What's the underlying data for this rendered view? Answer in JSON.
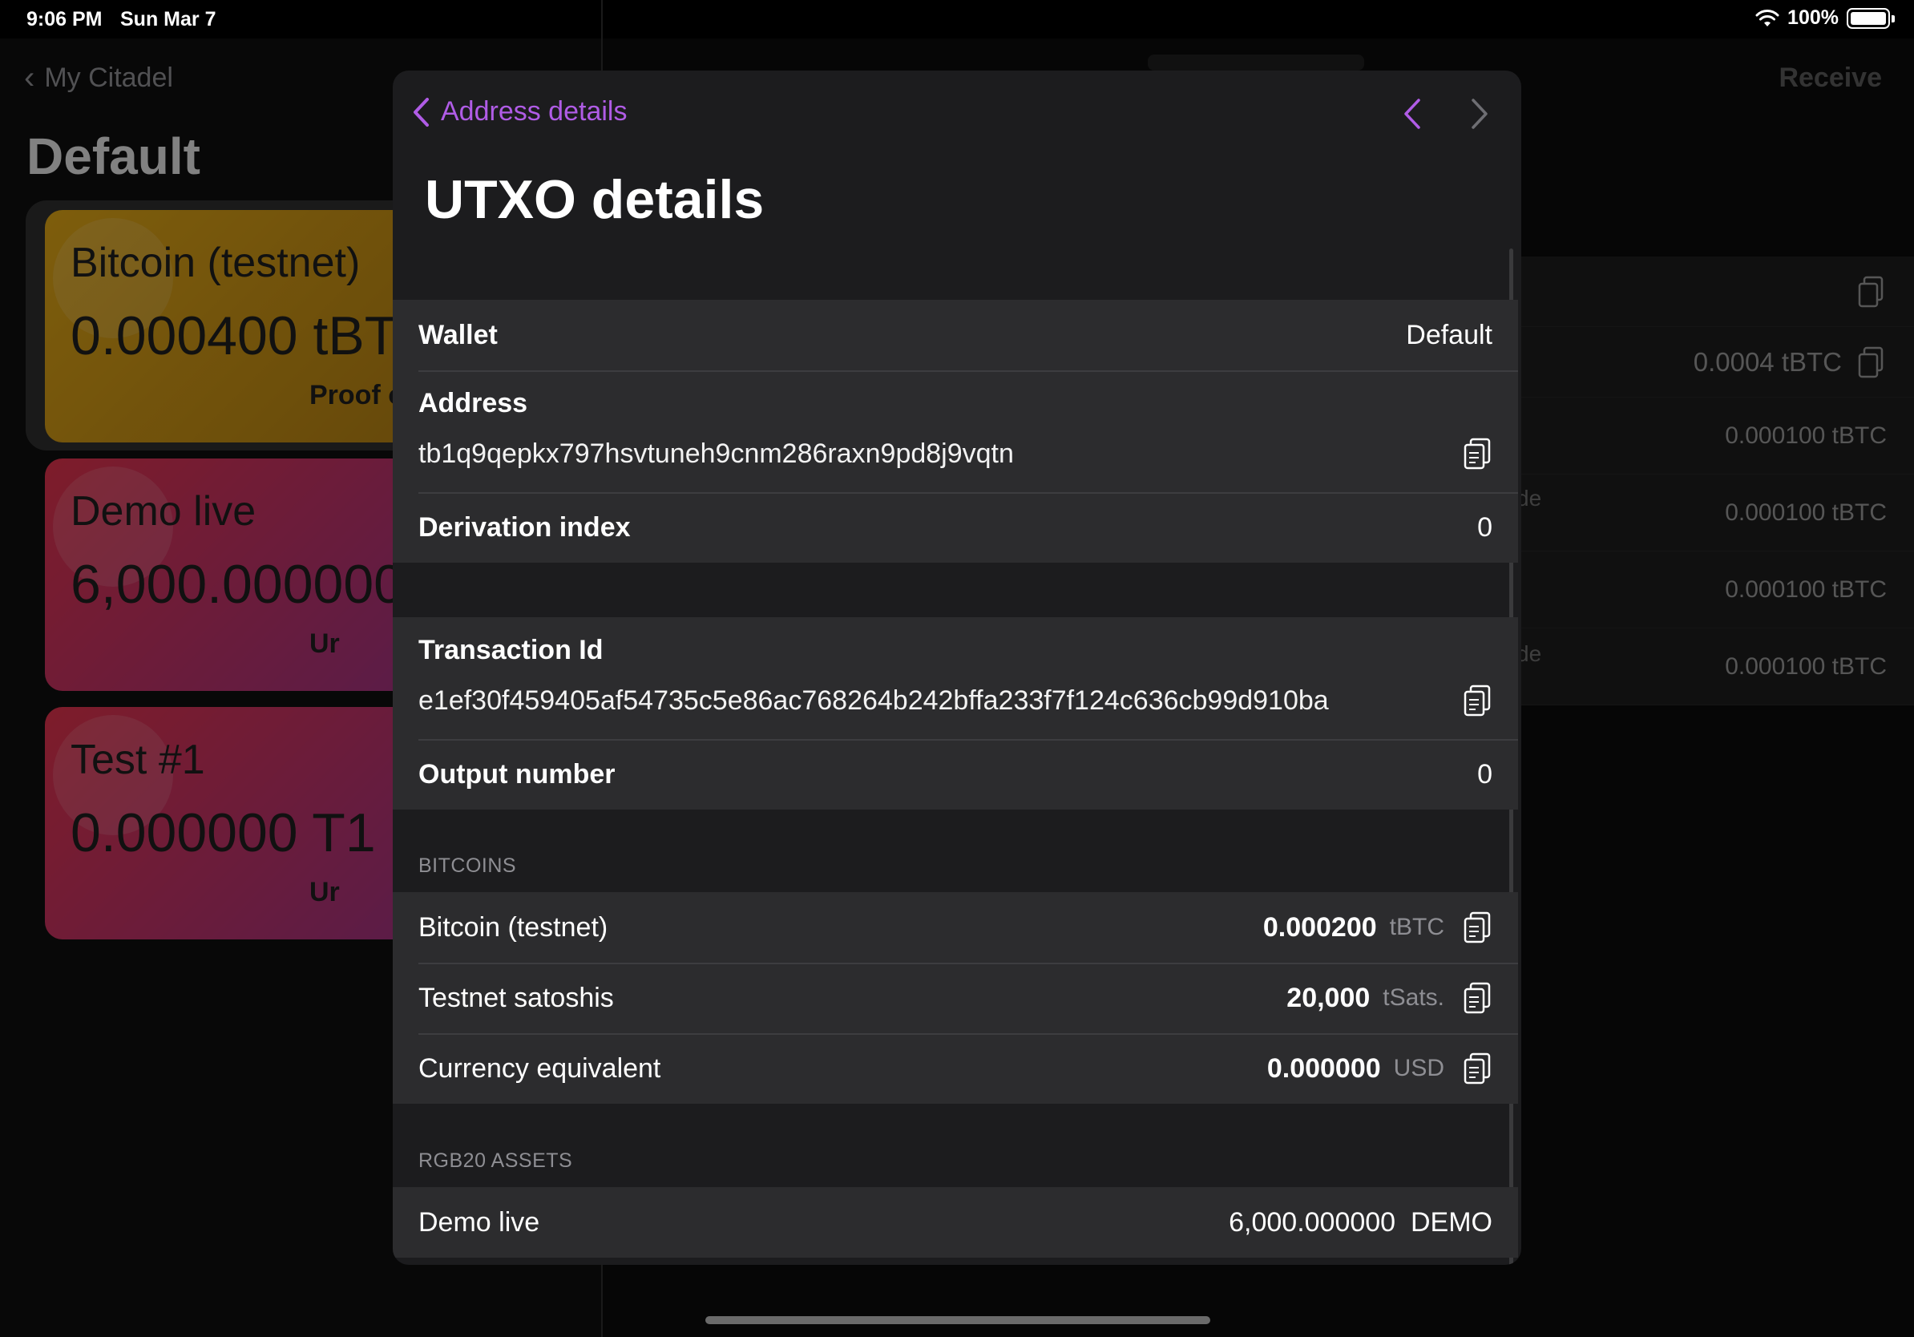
{
  "status_bar": {
    "time": "9:06 PM",
    "date": "Sun Mar 7",
    "battery": "100%"
  },
  "background": {
    "back_label": "My Citadel",
    "title": "Default",
    "receive_label": "Receive",
    "cards": [
      {
        "name": "Bitcoin (testnet)",
        "amount": "0.000400 tBT",
        "sub": "Proof o"
      },
      {
        "name": "Demo live",
        "amount": "6,000.000000",
        "sub": "Ur"
      },
      {
        "name": "Test #1",
        "amount": "0.000000 T1",
        "sub": "Ur"
      }
    ],
    "right_rows": [
      {
        "value": ""
      },
      {
        "value": "0.0004 tBTC"
      },
      {
        "value": "0.000100 tBTC"
      },
      {
        "value": "0.000100 tBTC"
      },
      {
        "value": "0.000100 tBTC"
      },
      {
        "value": "0.000100 tBTC"
      }
    ],
    "fragments": [
      "de",
      "de"
    ]
  },
  "sheet": {
    "back_label": "Address details",
    "title": "UTXO details",
    "info": {
      "wallet_label": "Wallet",
      "wallet_value": "Default",
      "address_label": "Address",
      "address_value": "tb1q9qepkx797hsvtuneh9cnm286raxn9pd8j9vqtn",
      "derivation_label": "Derivation index",
      "derivation_value": "0"
    },
    "tx": {
      "txid_label": "Transaction Id",
      "txid_value": "e1ef30f459405af54735c5e86ac768264b242bffa233f7f124c636cb99d910ba",
      "output_label": "Output number",
      "output_value": "0"
    },
    "bitcoins": {
      "header": "BITCOINS",
      "rows": [
        {
          "label": "Bitcoin (testnet)",
          "amount": "0.000200",
          "unit": "tBTC"
        },
        {
          "label": "Testnet satoshis",
          "amount": "20,000",
          "unit": "tSats."
        },
        {
          "label": "Currency equivalent",
          "amount": "0.000000",
          "unit": "USD"
        }
      ]
    },
    "rgb20": {
      "header": "RGB20 ASSETS",
      "rows": [
        {
          "label": "Demo live",
          "value": "6,000.000000  DEMO"
        }
      ]
    }
  },
  "colors": {
    "accent": "#b05ce6",
    "sheet_bg": "#1c1c1e",
    "row_bg": "#2c2c2e"
  }
}
